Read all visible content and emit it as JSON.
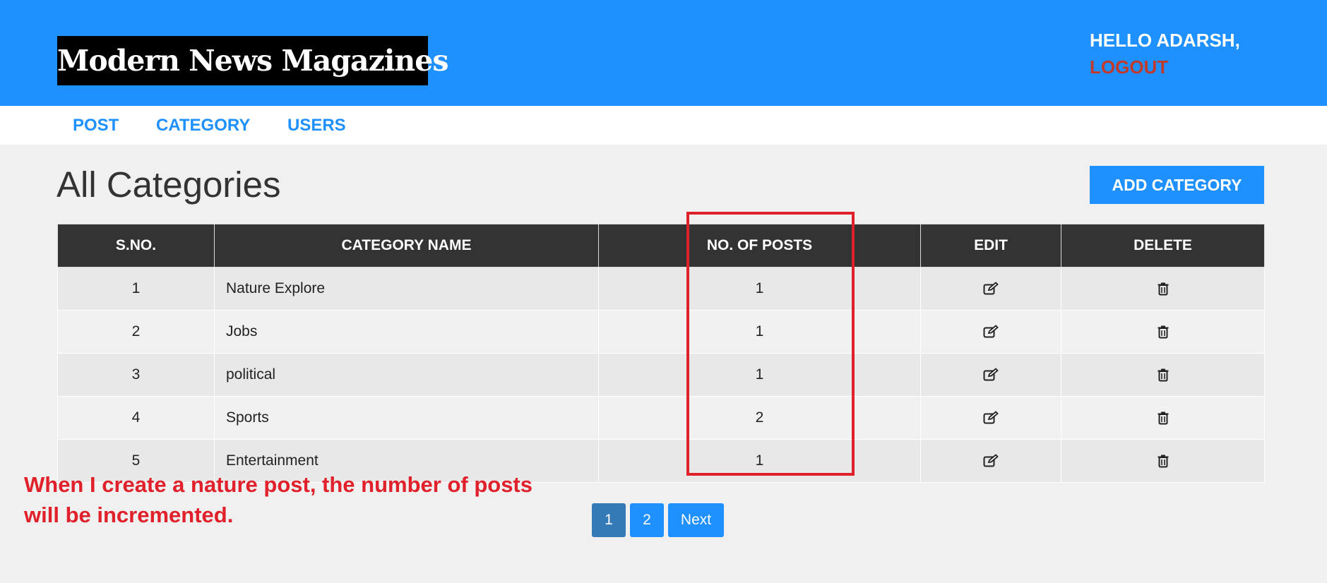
{
  "header": {
    "logo_text": "Modern News Magazines",
    "greeting": "HELLO ADARSH,",
    "logout_label": "LOGOUT",
    "brand_color": "#1e90ff"
  },
  "menu": {
    "items": [
      {
        "label": "POST"
      },
      {
        "label": "CATEGORY"
      },
      {
        "label": "USERS"
      }
    ]
  },
  "main": {
    "title": "All Categories",
    "add_button_label": "ADD CATEGORY"
  },
  "table": {
    "headers": [
      "S.NO.",
      "CATEGORY NAME",
      "NO. OF POSTS",
      "EDIT",
      "DELETE"
    ],
    "rows": [
      {
        "sno": "1",
        "name": "Nature Explore",
        "posts": "1",
        "edit_icon": "edit-icon",
        "delete_icon": "trash-icon"
      },
      {
        "sno": "2",
        "name": "Jobs",
        "posts": "1",
        "edit_icon": "edit-icon",
        "delete_icon": "trash-icon"
      },
      {
        "sno": "3",
        "name": "political",
        "posts": "1",
        "edit_icon": "edit-icon",
        "delete_icon": "trash-icon"
      },
      {
        "sno": "4",
        "name": "Sports",
        "posts": "2",
        "edit_icon": "edit-icon",
        "delete_icon": "trash-icon"
      },
      {
        "sno": "5",
        "name": "Entertainment",
        "posts": "1",
        "edit_icon": "edit-icon",
        "delete_icon": "trash-icon"
      }
    ]
  },
  "annotation": {
    "text": "When I create a nature post, the number of posts will be incremented.",
    "color": "#e0202a"
  },
  "pagination": {
    "pages": [
      "1",
      "2"
    ],
    "active_page": "1",
    "next_label": "Next"
  }
}
